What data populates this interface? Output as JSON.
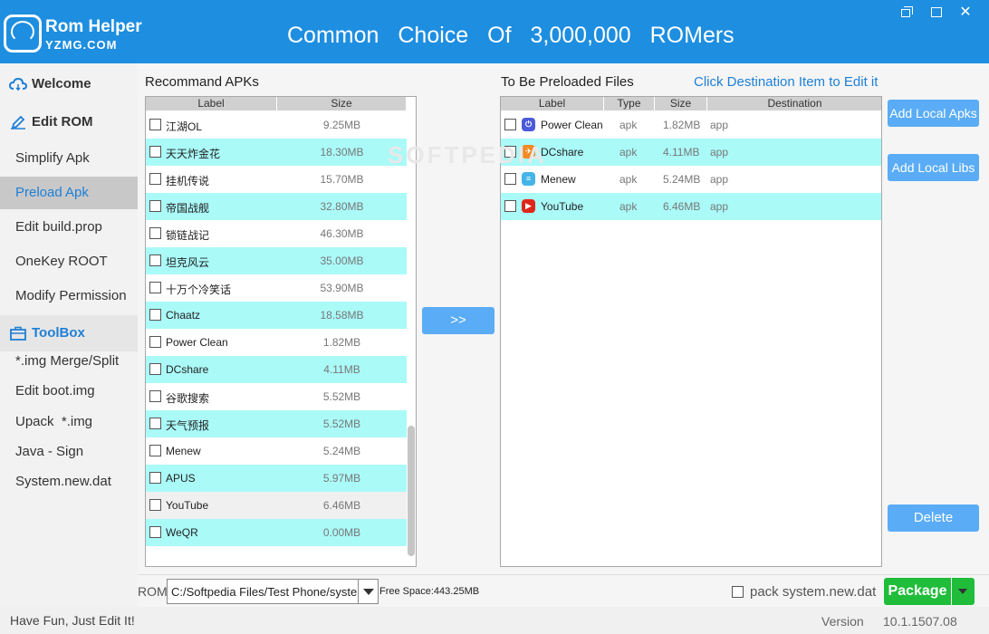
{
  "app": {
    "name": "Rom Helper",
    "subname": "YZMG.COM",
    "slogan": "Common Choice Of 3,000,000 ROMers",
    "window_controls": [
      "restore-icon",
      "maximize-icon",
      "close-icon"
    ]
  },
  "sidebar": {
    "sections": [
      {
        "label": "Welcome",
        "icon": "cloud-icon"
      },
      {
        "label": "Edit ROM",
        "icon": "pencil-icon"
      },
      {
        "label": "ToolBox",
        "icon": "toolbox-icon"
      }
    ],
    "edit_items": [
      "Simplify Apk",
      "Preload Apk",
      "Edit build.prop",
      "OneKey ROOT",
      "Modify Permission"
    ],
    "tool_items": [
      "*.img Merge/Split",
      "Edit boot.img",
      "Upack  *.img",
      "Java - Sign",
      "System.new.dat"
    ],
    "active_item": "Preload Apk"
  },
  "recommend": {
    "title": "Recommand APKs",
    "columns": [
      "Label",
      "Size"
    ],
    "rows": [
      {
        "label": "江湖OL",
        "size": "9.25MB"
      },
      {
        "label": "天天炸金花",
        "size": "18.30MB"
      },
      {
        "label": "挂机传说",
        "size": "15.70MB"
      },
      {
        "label": "帝国战舰",
        "size": "32.80MB"
      },
      {
        "label": "锁链战记",
        "size": "46.30MB"
      },
      {
        "label": "坦克风云",
        "size": "35.00MB"
      },
      {
        "label": "十万个冷笑话",
        "size": "53.90MB"
      },
      {
        "label": "Chaatz",
        "size": "18.58MB"
      },
      {
        "label": "Power Clean",
        "size": "1.82MB"
      },
      {
        "label": "DCshare",
        "size": "4.11MB"
      },
      {
        "label": "谷歌搜索",
        "size": "5.52MB"
      },
      {
        "label": "天气预报",
        "size": "5.52MB"
      },
      {
        "label": "Menew",
        "size": "5.24MB"
      },
      {
        "label": "APUS",
        "size": "5.97MB"
      },
      {
        "label": "YouTube",
        "size": "6.46MB"
      },
      {
        "label": "WeQR",
        "size": "0.00MB"
      }
    ]
  },
  "transfer_button": ">>",
  "preload": {
    "title": "To Be Preloaded Files",
    "hint": "Click Destination Item to Edit it",
    "columns": [
      "Label",
      "Type",
      "Size",
      "Destination"
    ],
    "rows": [
      {
        "label": "Power Clean",
        "type": "apk",
        "size": "1.82MB",
        "dest": "app",
        "icon": "power-clean-icon",
        "color": "#4a5ad8"
      },
      {
        "label": "DCshare",
        "type": "apk",
        "size": "4.11MB",
        "dest": "app",
        "icon": "dcshare-icon",
        "color": "#f08a24"
      },
      {
        "label": "Menew",
        "type": "apk",
        "size": "5.24MB",
        "dest": "app",
        "icon": "menew-icon",
        "color": "#45b4e8"
      },
      {
        "label": "YouTube",
        "type": "apk",
        "size": "6.46MB",
        "dest": "app",
        "icon": "youtube-icon",
        "color": "#e0261a"
      }
    ]
  },
  "actions": {
    "add_apks": "Add Local Apks",
    "add_libs": "Add Local Libs",
    "delete": "Delete"
  },
  "rom": {
    "label": "ROM",
    "path": "C:/Softpedia Files/Test Phone/system",
    "free_space": "Free Space:443.25MB",
    "pack_label": "pack system.new.dat",
    "package_label": "Package"
  },
  "footer": {
    "message": "Have Fun, Just Edit It!",
    "version_label": "Version",
    "version": "10.1.1507.08"
  },
  "watermark": "SOFTPEDIA",
  "colors": {
    "accent": "#1e8ee0",
    "row_highlight": "#aafaf8",
    "button_blue": "#5aacf6",
    "package_green": "#1fbd3a"
  }
}
